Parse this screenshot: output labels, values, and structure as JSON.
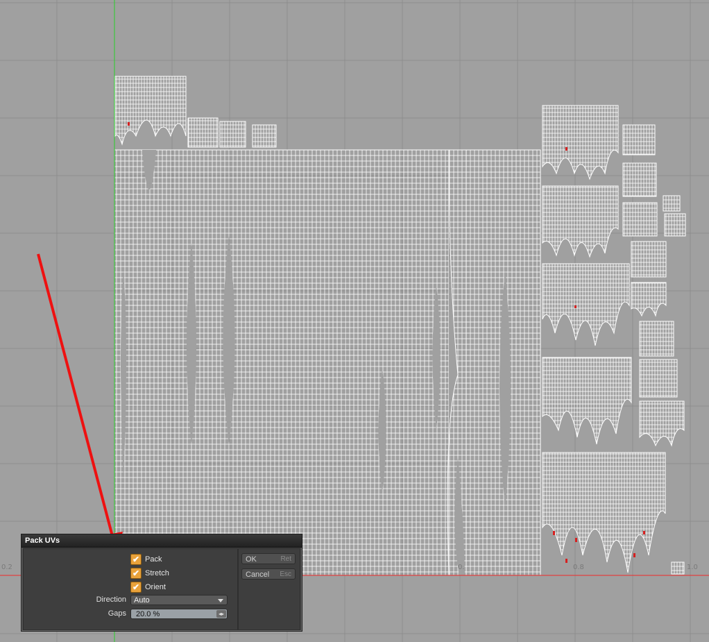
{
  "viewport": {
    "axis_labels": [
      "0.2",
      "0.",
      "0.8",
      "1.0"
    ],
    "colors": {
      "background": "#a0a0a0",
      "grid": "#8e8e8e",
      "uv_wire": "#ffffff",
      "v_axis": "#3cc83c",
      "u_axis": "#e04040",
      "annotation_arrow": "#ee1111"
    }
  },
  "dialog": {
    "title": "Pack UVs",
    "options": [
      {
        "label": "Pack",
        "checked": true
      },
      {
        "label": "Stretch",
        "checked": true
      },
      {
        "label": "Orient",
        "checked": true
      }
    ],
    "direction": {
      "label": "Direction",
      "value": "Auto"
    },
    "gaps": {
      "label": "Gaps",
      "value": "20.0 %"
    },
    "ok": {
      "label": "OK",
      "key": "Ret"
    },
    "cancel": {
      "label": "Cancel",
      "key": "Esc"
    },
    "checkmark": "✔",
    "spinner_glyph": "◂▸"
  }
}
